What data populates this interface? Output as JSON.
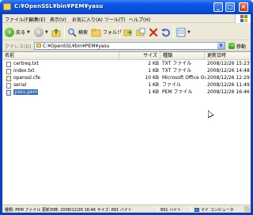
{
  "window": {
    "title": "C:¥OpenSSL¥bin¥PEM¥yasu",
    "minimize_glyph": "_",
    "maximize_glyph": "□",
    "close_glyph": "×"
  },
  "menu": {
    "file": "ファイル(F)",
    "edit": "編集(E)",
    "view": "表示(V)",
    "favorites": "お気に入り(A)",
    "tools": "ツール(T)",
    "help": "ヘルプ(H)"
  },
  "toolbar": {
    "back_label": "戻る",
    "search_label": "検索",
    "folders_label": "フォルダ"
  },
  "address": {
    "label": "アドレス(D)",
    "value": "C:¥OpenSSL¥bin¥PEM¥yasu",
    "go_label": "移動"
  },
  "columns": {
    "name": "名前",
    "size": "サイズ",
    "type": "種類",
    "date": "更新日時"
  },
  "files": [
    {
      "name": "certreq.txt",
      "size": "2 KB",
      "type": "TXT ファイル",
      "date": "2008/12/26 15:23"
    },
    {
      "name": "index.txt",
      "size": "1 KB",
      "type": "TXT ファイル",
      "date": "2008/12/26 14:48"
    },
    {
      "name": "openssl.cfe",
      "size": "10 KB",
      "type": "Microsoft Office Ou...",
      "date": "2008/12/26 12:29"
    },
    {
      "name": "serial",
      "size": "1 KB",
      "type": "ファイル",
      "date": "2008/12/26 11:49"
    },
    {
      "name": "yasu.pem",
      "size": "1 KB",
      "type": "PEM ファイル",
      "date": "2008/12/26 16:46"
    }
  ],
  "status": {
    "info": "種類: PEM ファイル 更新日時: 2008/12/26 16:46 サイズ: 891 バイト",
    "size": "891 バイト",
    "zone": "マイ コンピュータ"
  },
  "colors": {
    "titlebar": "#0a4fd8",
    "selection": "#316ac5",
    "chrome": "#ece9d8"
  }
}
